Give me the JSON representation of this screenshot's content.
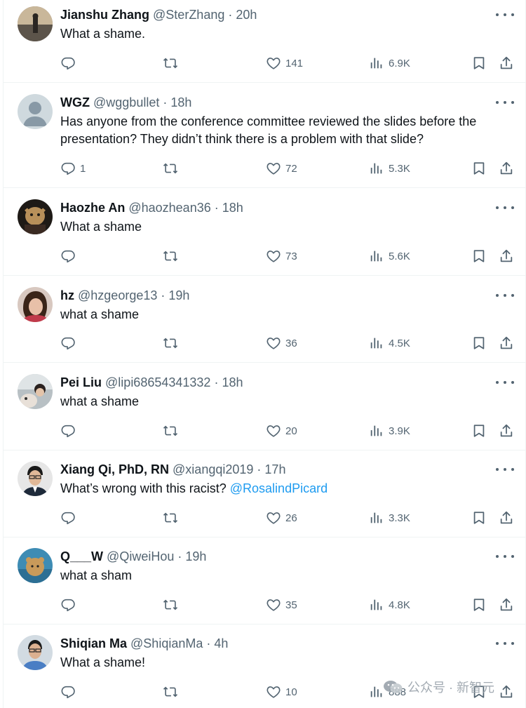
{
  "colors": {
    "text": "#0f1419",
    "secondary": "#536471",
    "link": "#1d9bf0",
    "divider": "#eff3f4"
  },
  "icons": {
    "reply": "reply-icon",
    "retweet": "retweet-icon",
    "like": "heart-icon",
    "views": "views-icon",
    "bookmark": "bookmark-icon",
    "share": "share-icon",
    "more": "more-icon"
  },
  "tweets": [
    {
      "name": "Jianshu Zhang",
      "handle": "@SterZhang",
      "dot": "·",
      "time": "20h",
      "text": "What a shame.",
      "replies": "",
      "likes": "141",
      "views": "6.9K"
    },
    {
      "name": "WGZ",
      "handle": "@wggbullet",
      "dot": "·",
      "time": "18h",
      "text": "Has anyone from the conference committee reviewed the slides before the presentation? They didn’t think there is a problem with that slide?",
      "replies": "1",
      "likes": "72",
      "views": "5.3K"
    },
    {
      "name": "Haozhe An",
      "handle": "@haozhean36",
      "dot": "·",
      "time": "18h",
      "text": "What a shame",
      "replies": "",
      "likes": "73",
      "views": "5.6K"
    },
    {
      "name": "hz",
      "handle": "@hzgeorge13",
      "dot": "·",
      "time": "19h",
      "text": "what a shame",
      "replies": "",
      "likes": "36",
      "views": "4.5K"
    },
    {
      "name": "Pei Liu",
      "handle": "@lipi68654341332",
      "dot": "·",
      "time": "18h",
      "text": "what a shame",
      "replies": "",
      "likes": "20",
      "views": "3.9K"
    },
    {
      "name": "Xiang Qi, PhD, RN",
      "handle": "@xiangqi2019",
      "dot": "·",
      "time": "17h",
      "text": "What’s wrong with this racist? ",
      "mention": "@RosalindPicard",
      "replies": "",
      "likes": "26",
      "views": "3.3K"
    },
    {
      "name": "Q___W",
      "handle": "@QiweiHou",
      "dot": "·",
      "time": "19h",
      "text": "what a sham",
      "replies": "",
      "likes": "35",
      "views": "4.8K"
    },
    {
      "name": "Shiqian Ma",
      "handle": "@ShiqianMa",
      "dot": "·",
      "time": "4h",
      "text": "What a shame!",
      "replies": "",
      "likes": "10",
      "views": "888"
    }
  ],
  "watermark": {
    "text": "公众号 · 新智元"
  }
}
